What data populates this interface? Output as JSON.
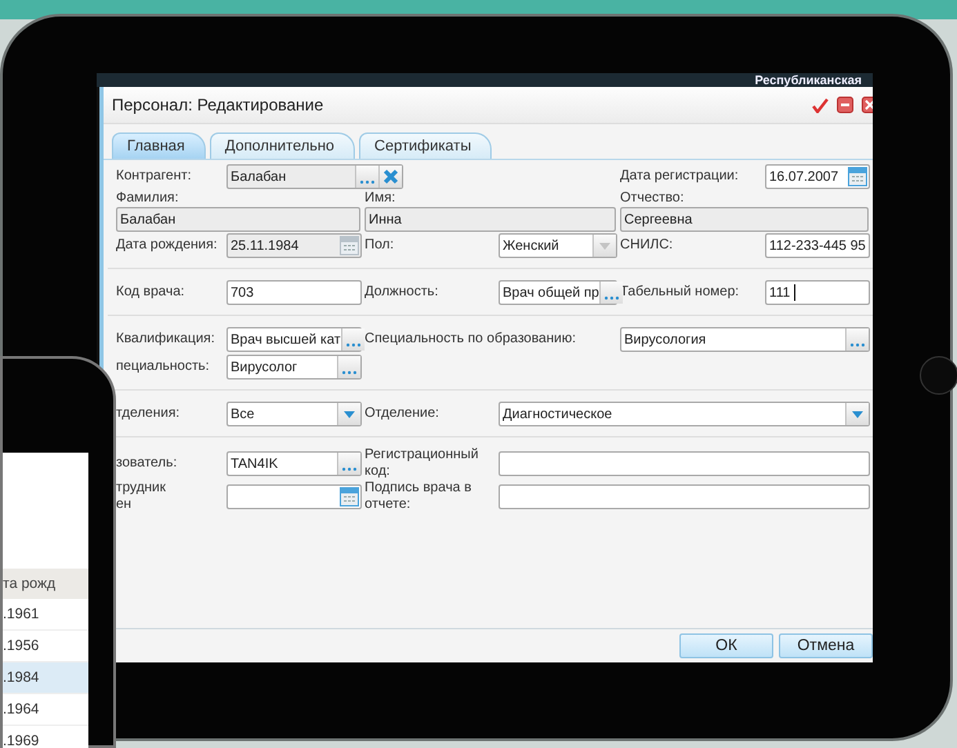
{
  "screen_banner": "Республиканская",
  "dialog": {
    "title": "Персонал: Редактирование",
    "tabs": [
      {
        "label": "Главная",
        "selected": true
      },
      {
        "label": "Дополнительно",
        "selected": false
      },
      {
        "label": "Сертификаты",
        "selected": false
      }
    ],
    "rows": [
      {
        "kind": "inline",
        "left": {
          "label": "Контрагент:",
          "field": {
            "kind": "lookup-clear",
            "value": "Балабан",
            "readonly": true
          }
        },
        "right": {
          "label": "Дата регистрации:",
          "field": {
            "kind": "date",
            "value": "16.07.2007",
            "readonly": false
          }
        }
      },
      {
        "kind": "stacked",
        "left": {
          "label": "Фамилия:",
          "field": {
            "kind": "text",
            "value": "Балабан",
            "readonly": true
          }
        },
        "middle": {
          "label": "Имя:",
          "field": {
            "kind": "text",
            "value": "Инна",
            "readonly": true
          }
        },
        "right": {
          "label": "Отчество:",
          "field": {
            "kind": "text",
            "value": "Сергеевна",
            "readonly": true
          }
        }
      },
      {
        "kind": "inline",
        "left": {
          "label": "Дата рождения:",
          "field": {
            "kind": "date",
            "value": "25.11.1984",
            "readonly": true
          }
        },
        "middle": {
          "label": "Пол:",
          "field": {
            "kind": "combo",
            "value": "Женский",
            "readonly": false,
            "disabled": true
          }
        },
        "right": {
          "label": "СНИЛС:",
          "field": {
            "kind": "text",
            "value": "112-233-445 95",
            "readonly": false
          }
        }
      },
      {
        "kind": "divider"
      },
      {
        "kind": "inline",
        "left": {
          "label": "Код врача:",
          "field": {
            "kind": "text",
            "value": "703",
            "readonly": false
          }
        },
        "middle": {
          "label": "Должность:",
          "field": {
            "kind": "lookup",
            "value": "Врач общей пр",
            "readonly": false
          }
        },
        "right": {
          "label": "Табельный номер:",
          "field": {
            "kind": "text",
            "value": "111",
            "readonly": false,
            "focused": true
          }
        }
      },
      {
        "kind": "divider"
      },
      {
        "kind": "inline",
        "left": {
          "label": "Квалификация:",
          "field": {
            "kind": "lookup",
            "value": "Врач высшей кат",
            "readonly": false
          }
        },
        "middle": {
          "label": "Специальность по образованию:"
        },
        "right": {
          "field": {
            "kind": "lookup",
            "value": "Вирусология",
            "readonly": false
          }
        }
      },
      {
        "kind": "inline",
        "left": {
          "label": "пециальность:",
          "field": {
            "kind": "lookup",
            "value": "Вирусолог",
            "readonly": false
          }
        }
      },
      {
        "kind": "divider"
      },
      {
        "kind": "inline",
        "left": {
          "label": "тделения:",
          "field": {
            "kind": "combo",
            "value": "Все",
            "readonly": false,
            "disabled": false
          }
        },
        "middle": {
          "label": "Отделение:",
          "field": {
            "kind": "combo",
            "value": "Диагностическое",
            "readonly": false,
            "disabled": false
          }
        }
      },
      {
        "kind": "divider"
      },
      {
        "kind": "inline",
        "left": {
          "label": "зователь:",
          "field": {
            "kind": "lookup",
            "value": "TAN4IK",
            "readonly": false
          }
        },
        "middle": {
          "label": "Регистрационный код:",
          "field": {
            "kind": "text",
            "readonly": false
          }
        }
      },
      {
        "kind": "inline",
        "left": {
          "label": "трудник\nен",
          "field": {
            "kind": "date",
            "readonly": false
          }
        },
        "middle": {
          "label": "Подпись врача в отчете:",
          "field": {
            "kind": "text",
            "readonly": false
          }
        }
      }
    ],
    "buttons": [
      "ОК",
      "Отмена"
    ]
  },
  "phone": {
    "column": "та рожд",
    "rows": [
      {
        "value": ".1961",
        "selected": false
      },
      {
        "value": ".1956",
        "selected": false
      },
      {
        "value": ".1984",
        "selected": true
      },
      {
        "value": ".1964",
        "selected": false
      },
      {
        "value": ".1969",
        "selected": false
      }
    ]
  }
}
